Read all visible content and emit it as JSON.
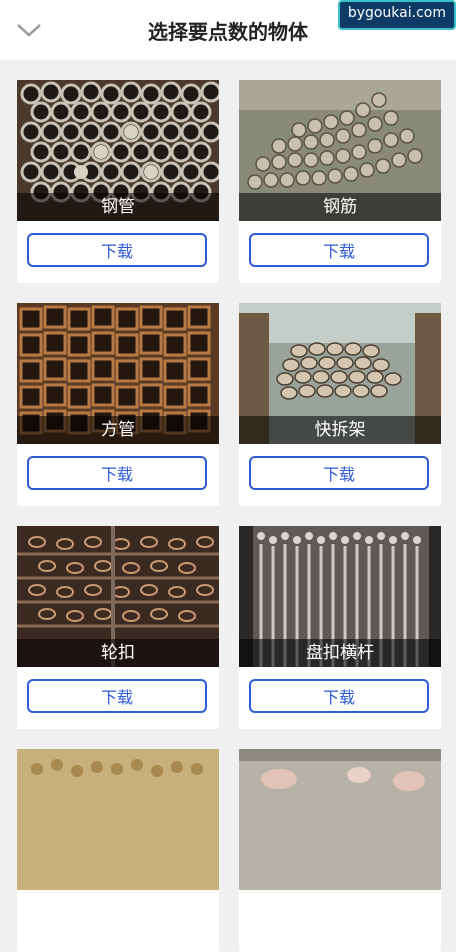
{
  "header": {
    "title": "选择要点数的物体",
    "watermark": "bygoukai.com"
  },
  "items": [
    {
      "label": "钢管",
      "button": "下载",
      "image": "steel-pipes-image"
    },
    {
      "label": "钢筋",
      "button": "下载",
      "image": "rebar-bundle-image"
    },
    {
      "label": "方管",
      "button": "下载",
      "image": "square-tubes-image"
    },
    {
      "label": "快拆架",
      "button": "下载",
      "image": "quick-release-scaffold-image"
    },
    {
      "label": "轮扣",
      "button": "下载",
      "image": "wheel-buckle-image"
    },
    {
      "label": "盘扣横杆",
      "button": "下载",
      "image": "disc-buckle-crossbar-image"
    },
    {
      "label": "",
      "button": "",
      "image": "bamboo-poles-image"
    },
    {
      "label": "",
      "button": "",
      "image": "pigs-image"
    }
  ],
  "colors": {
    "accent": "#2f5bd6",
    "caption_bg": "#000000"
  }
}
